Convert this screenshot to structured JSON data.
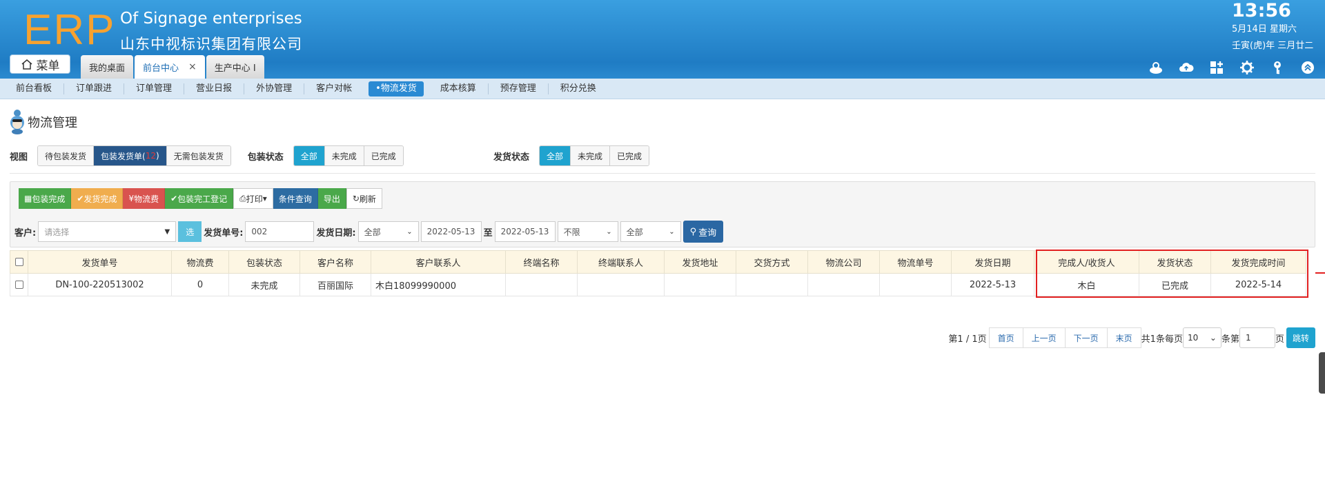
{
  "header": {
    "logo": "ERP",
    "company_en": "Of Signage enterprises",
    "company_cn": "山东中视标识集团有限公司",
    "time": "13:56",
    "date": "5月14日 星期六",
    "lunar": "壬寅(虎)年 三月廿二",
    "menu_label": "菜单",
    "tabs": [
      {
        "label": "我的桌面"
      },
      {
        "label": "前台中心",
        "close": "×"
      },
      {
        "label": "生产中心 I"
      }
    ],
    "icons": [
      "user-icon",
      "cloud-icon",
      "apps-icon",
      "gear-icon",
      "key-icon",
      "collapse-icon"
    ]
  },
  "nav": {
    "items": [
      "前台看板",
      "订单跟进",
      "订单管理",
      "营业日报",
      "外协管理",
      "客户对帐",
      "•物流发货",
      "成本核算",
      "预存管理",
      "积分兑换"
    ]
  },
  "page": {
    "title": "物流管理"
  },
  "filters": {
    "view_label": "视图",
    "view_options": [
      "待包装发货",
      "无需包装发货"
    ],
    "view_active_prefix": "包装发货单(",
    "view_active_count": "12",
    "view_active_suffix": ")",
    "pack_label": "包装状态",
    "pack_options": [
      "全部",
      "未完成",
      "已完成"
    ],
    "ship_label": "发货状态",
    "ship_options": [
      "全部",
      "未完成",
      "已完成"
    ]
  },
  "toolbar": {
    "pack_done": "包装完成",
    "ship_done": "发货完成",
    "freight": "物流费",
    "pack_register": "包装完工登记",
    "print": "打印",
    "cond_query": "条件查询",
    "export": "导出",
    "refresh": "刷新"
  },
  "search": {
    "customer_label": "客户:",
    "customer_placeholder": "请选择",
    "pick": "选",
    "ship_no_label": "发货单号:",
    "ship_no_value": "002",
    "ship_date_label": "发货日期:",
    "date_range": "全部",
    "date_from": "2022-05-13",
    "to": "至",
    "date_to": "2022-05-13",
    "limit": "不限",
    "status": "全部",
    "query": "查询"
  },
  "table": {
    "headers": [
      "发货单号",
      "物流费",
      "包装状态",
      "客户名称",
      "客户联系人",
      "终端名称",
      "终端联系人",
      "发货地址",
      "交货方式",
      "物流公司",
      "物流单号",
      "发货日期",
      "完成人/收货人",
      "发货状态",
      "发货完成时间"
    ],
    "rows": [
      [
        "DN-100-220513002",
        "0",
        "未完成",
        "百丽国际",
        "木白18099990000",
        "",
        "",
        "",
        "",
        "",
        "",
        "2022-5-13",
        "木白",
        "已完成",
        "2022-5-14"
      ]
    ]
  },
  "pager": {
    "page_info": "第1 / 1页",
    "first": "首页",
    "prev": "上一页",
    "next": "下一页",
    "last": "末页",
    "total_prefix": "共1条每页",
    "per_page": "10",
    "per_page_suffix": "条第",
    "page_input": "1",
    "page_suffix": "页",
    "jump": "跳转"
  }
}
